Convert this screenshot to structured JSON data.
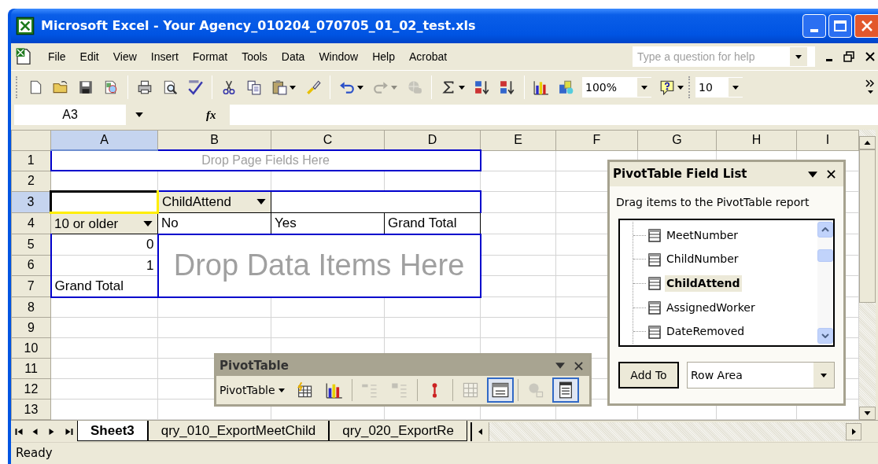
{
  "window": {
    "title": "Microsoft Excel - Your Agency_010204_070705_01_02_test.xls"
  },
  "menu_bar": {
    "items": [
      "File",
      "Edit",
      "View",
      "Insert",
      "Format",
      "Tools",
      "Data",
      "Window",
      "Help",
      "Acrobat"
    ],
    "help_box": {
      "placeholder": "Type a question for help"
    }
  },
  "standard_toolbar": {
    "buttons": [
      {
        "disabled": false
      },
      {
        "disabled": false
      },
      {
        "disabled": false
      },
      {
        "disabled": false
      },
      {
        "disabled": false
      },
      {
        "disabled": false
      },
      {
        "disabled": false
      },
      {
        "disabled": false
      },
      {
        "disabled": false
      },
      {
        "disabled": false
      },
      {
        "disabled": false
      },
      {
        "disabled": false
      },
      {
        "disabled": true
      },
      {
        "disabled": true
      },
      {
        "disabled": false
      },
      {
        "disabled": false
      },
      {
        "disabled": false
      },
      {
        "disabled": false
      },
      {
        "disabled": false
      },
      {
        "disabled": false
      }
    ],
    "zoom": "100%",
    "font_size": "10"
  },
  "formula_bar": {
    "name_box": "A3",
    "function_label": "fx"
  },
  "sheet": {
    "columns": [
      {
        "label": "A",
        "selected": true
      },
      {
        "label": "B",
        "selected": false
      },
      {
        "label": "C",
        "selected": false
      },
      {
        "label": "D",
        "selected": false
      },
      {
        "label": "E",
        "selected": false
      },
      {
        "label": "F",
        "selected": false
      },
      {
        "label": "G",
        "selected": false
      },
      {
        "label": "H",
        "selected": false
      },
      {
        "label": "I",
        "selected": false
      }
    ],
    "rows": [
      {
        "label": "1",
        "selected": false,
        "cells": [
          {
            "kind": "page_drop",
            "text": "Drop Page Fields Here",
            "colspan": 4
          }
        ]
      },
      {
        "label": "2",
        "selected": false,
        "cells": []
      },
      {
        "label": "3",
        "selected": true,
        "cells": [
          {
            "kind": "active"
          },
          {
            "kind": "column_field",
            "text": "ChildAttend"
          },
          {
            "kind": "area",
            "colspan": 2
          }
        ]
      },
      {
        "label": "4",
        "selected": false,
        "cells": [
          {
            "kind": "row_field",
            "text": "10 or older"
          },
          {
            "kind": "column_item",
            "text": "No"
          },
          {
            "kind": "column_item",
            "text": "Yes"
          },
          {
            "kind": "column_item",
            "text": "Grand Total"
          }
        ]
      },
      {
        "label": "5",
        "selected": false,
        "cells": [
          {
            "kind": "row_item",
            "text": "0"
          },
          {
            "kind": "data_drop",
            "text": "Drop Data Items Here",
            "colspan": 3,
            "rowspan": 3
          }
        ]
      },
      {
        "label": "6",
        "selected": false,
        "cells": [
          {
            "kind": "row_item",
            "text": "1"
          }
        ]
      },
      {
        "label": "7",
        "selected": false,
        "cells": [
          {
            "kind": "row_total",
            "text": "Grand Total"
          }
        ]
      },
      {
        "label": "8",
        "selected": false,
        "cells": []
      },
      {
        "label": "9",
        "selected": false,
        "cells": []
      },
      {
        "label": "10",
        "selected": false,
        "cells": []
      },
      {
        "label": "11",
        "selected": false,
        "cells": []
      },
      {
        "label": "12",
        "selected": false,
        "cells": []
      },
      {
        "label": "13",
        "selected": false,
        "cells": []
      }
    ]
  },
  "pivot_toolbar": {
    "title": "PivotTable",
    "menu": "PivotTable",
    "buttons": [
      {
        "disabled": false,
        "pressed": false
      },
      {
        "disabled": false,
        "pressed": false
      },
      {
        "disabled": true,
        "pressed": false
      },
      {
        "disabled": true,
        "pressed": false
      },
      {
        "disabled": false,
        "pressed": false
      },
      {
        "disabled": true,
        "pressed": false
      },
      {
        "disabled": false,
        "pressed": true
      },
      {
        "disabled": true,
        "pressed": false
      },
      {
        "disabled": false,
        "pressed": true
      }
    ]
  },
  "field_list": {
    "title": "PivotTable Field List",
    "instruction": "Drag items to the PivotTable report",
    "fields": [
      {
        "name": "MeetNumber",
        "selected": false
      },
      {
        "name": "ChildNumber",
        "selected": false
      },
      {
        "name": "ChildAttend",
        "selected": true
      },
      {
        "name": "AssignedWorker",
        "selected": false
      },
      {
        "name": "DateRemoved",
        "selected": false
      }
    ],
    "add_button": "Add To",
    "area": "Row Area"
  },
  "sheet_tabs": {
    "tabs": [
      {
        "label": "Sheet3",
        "selected": true
      },
      {
        "label": "qry_010_ExportMeetChild",
        "selected": false
      },
      {
        "label": "qry_020_ExportRe",
        "selected": false
      }
    ]
  },
  "status_bar": {
    "text": "Ready"
  }
}
